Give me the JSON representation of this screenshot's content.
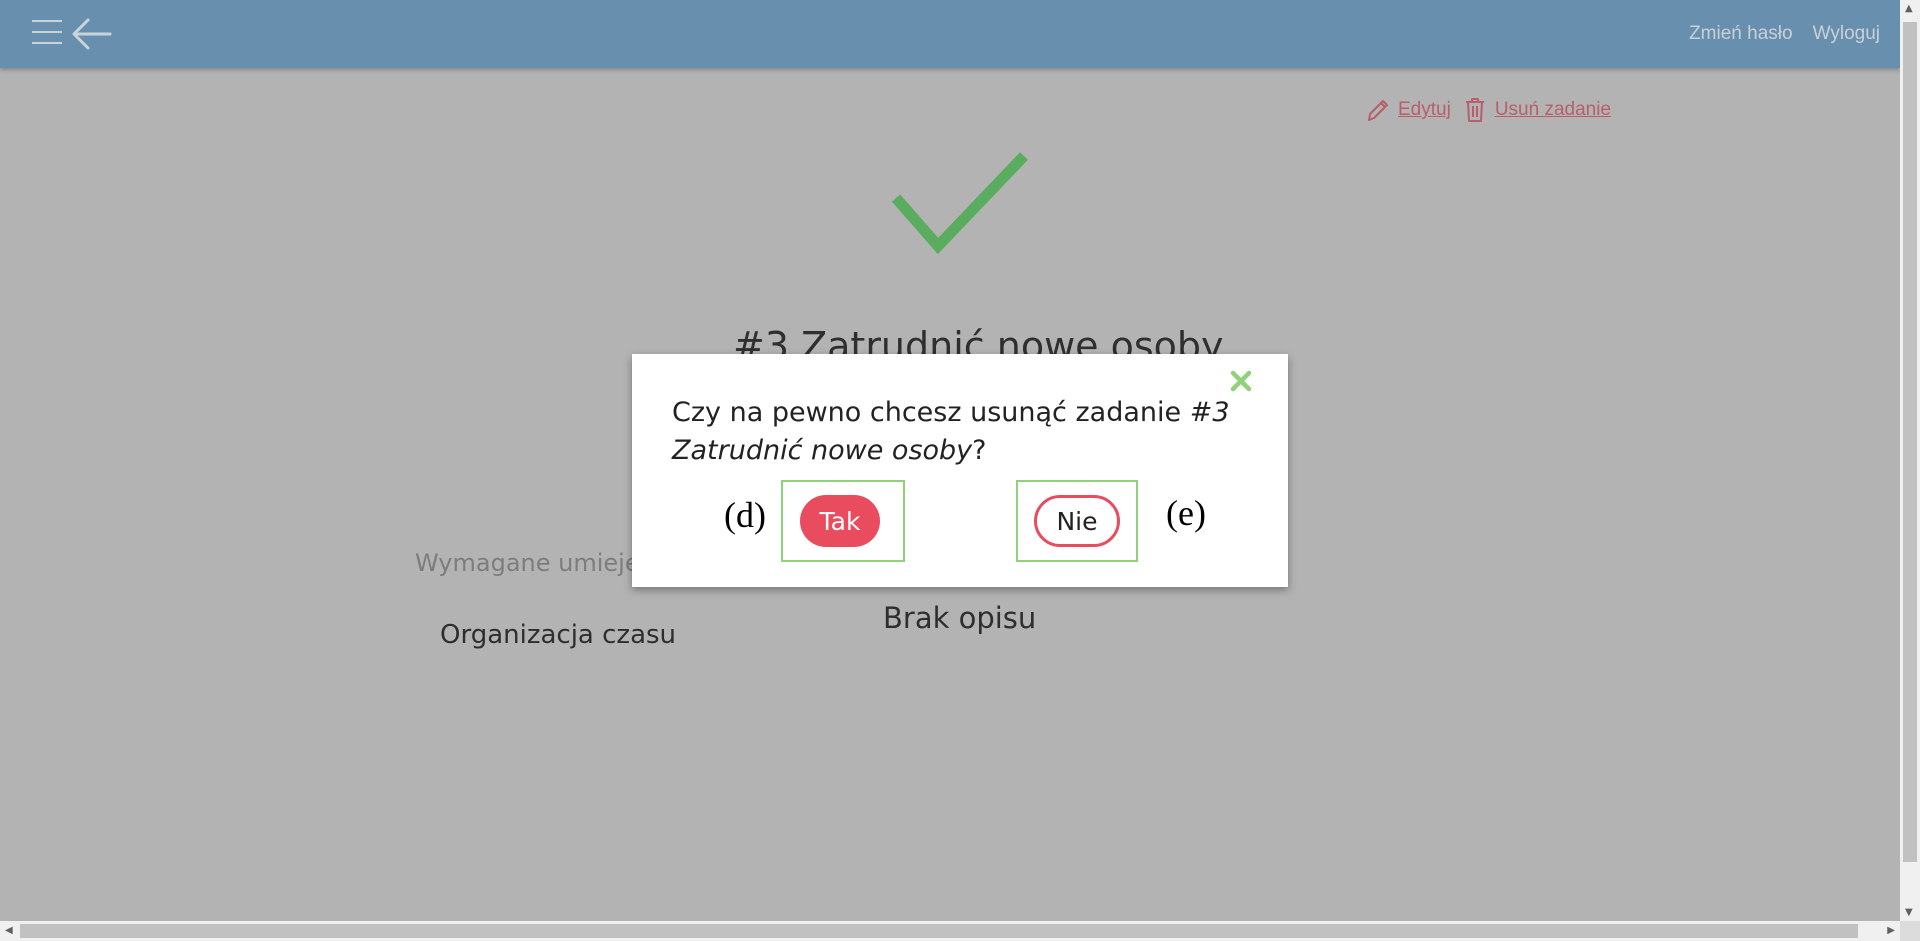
{
  "header": {
    "menu_icon": "hamburger-icon",
    "back_icon": "arrow-left-icon",
    "change_password": "Zmień hasło",
    "logout": "Wyloguj"
  },
  "actions": {
    "edit_label": "Edytuj",
    "delete_label": "Usuń zadanie",
    "edit_icon": "pencil-icon",
    "delete_icon": "trash-icon"
  },
  "task": {
    "status_icon": "checkmark-icon",
    "title": "#3 Zatrudnić nowe osoby",
    "skills_label": "Wymagane umiejętności",
    "skills": [
      "Organizacja czasu"
    ],
    "description": "Brak opisu"
  },
  "modal": {
    "question_prefix": "Czy na pewno chcesz usunąć zadanie ",
    "question_task": "#3 Zatrudnić nowe osoby",
    "question_suffix": "?",
    "yes_label": "Tak",
    "no_label": "Nie",
    "annotation_yes": "(d)",
    "annotation_no": "(e)"
  },
  "colors": {
    "header_bg": "#6890ae",
    "accent_red": "#e94c5e",
    "check_green": "#5aac5e",
    "highlight_green": "#8fd27a",
    "overlay_bg": "#b3b3b3"
  }
}
